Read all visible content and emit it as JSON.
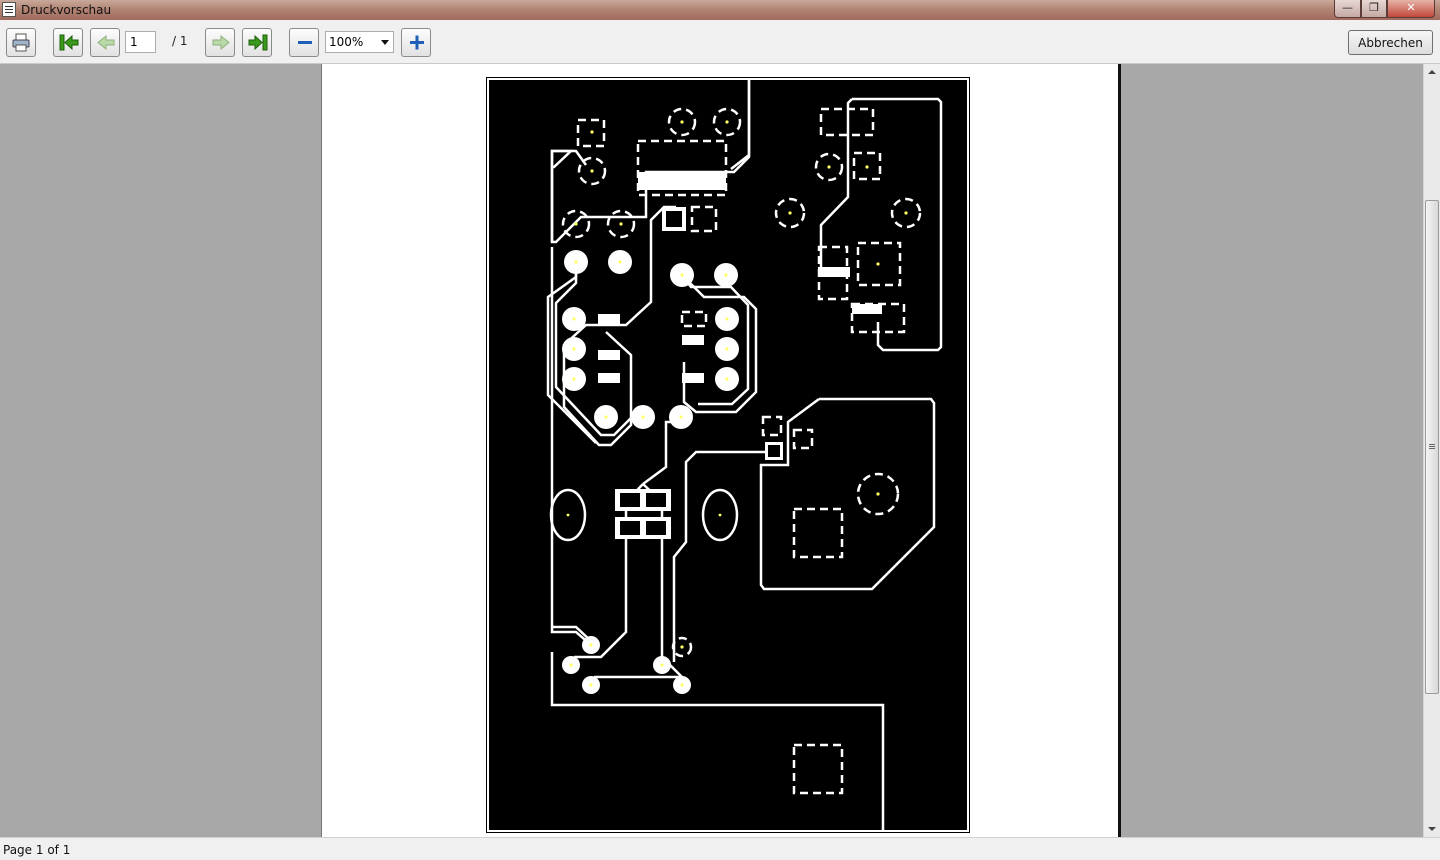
{
  "window": {
    "title": "Druckvorschau",
    "buttons": {
      "minimize": "—",
      "maximize": "❐",
      "close": "✕"
    }
  },
  "toolbar": {
    "print_icon": "printer-icon",
    "first_icon": "first-page-icon",
    "prev_icon": "previous-page-icon",
    "next_icon": "next-page-icon",
    "last_icon": "last-page-icon",
    "zoom_out_icon": "zoom-out-icon",
    "zoom_in_icon": "zoom-in-icon",
    "page_value": "1",
    "page_total": "/ 1",
    "zoom_value": "100%",
    "cancel_label": "Abbrechen"
  },
  "status": {
    "text": "Page 1 of 1"
  },
  "colors": {
    "accent_green": "#3a9a1c",
    "zoom_blue": "#1f5fb8",
    "pcb_background": "#000000",
    "pcb_trace": "#ffffff",
    "drill_mark": "#ffff66"
  }
}
